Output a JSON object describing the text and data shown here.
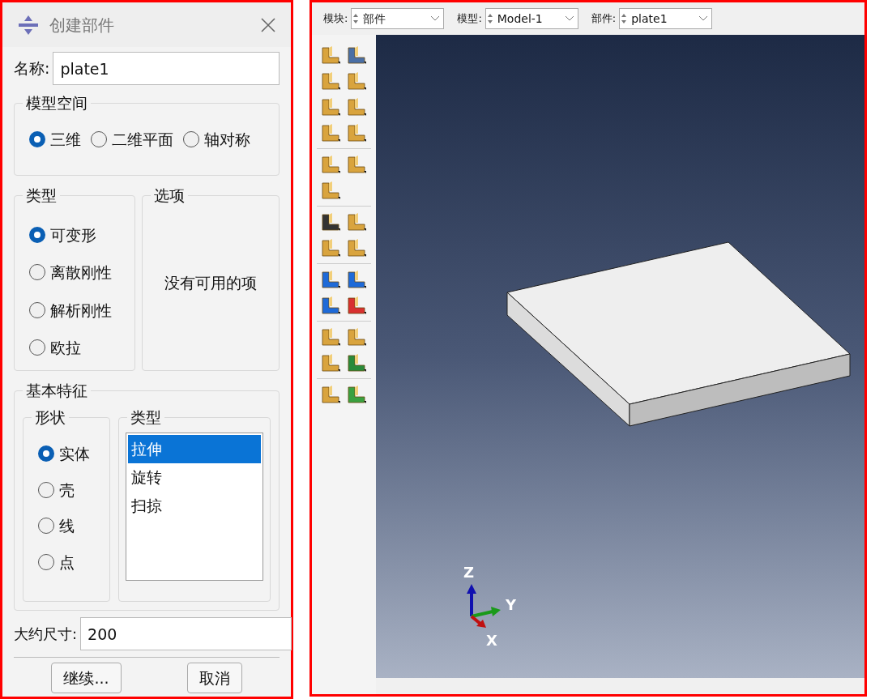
{
  "dialog": {
    "title": "创建部件",
    "name_label": "名称:",
    "name_value": "plate1",
    "model_space": {
      "title": "模型空间",
      "options": [
        {
          "label": "三维",
          "selected": true
        },
        {
          "label": "二维平面",
          "selected": false
        },
        {
          "label": "轴对称",
          "selected": false
        }
      ]
    },
    "type": {
      "title": "类型",
      "options": [
        {
          "label": "可变形",
          "selected": true
        },
        {
          "label": "离散刚性",
          "selected": false
        },
        {
          "label": "解析刚性",
          "selected": false
        },
        {
          "label": "欧拉",
          "selected": false
        }
      ]
    },
    "options_panel": {
      "title": "选项",
      "empty_text": "没有可用的项"
    },
    "base_feature": {
      "title": "基本特征",
      "shape": {
        "title": "形状",
        "options": [
          {
            "label": "实体",
            "selected": true
          },
          {
            "label": "壳",
            "selected": false
          },
          {
            "label": "线",
            "selected": false
          },
          {
            "label": "点",
            "selected": false
          }
        ]
      },
      "type": {
        "title": "类型",
        "items": [
          {
            "label": "拉伸",
            "selected": true
          },
          {
            "label": "旋转",
            "selected": false
          },
          {
            "label": "扫掠",
            "selected": false
          }
        ]
      }
    },
    "size_label": "大约尺寸:",
    "size_value": "200",
    "buttons": [
      "继续...",
      "取消"
    ]
  },
  "viewport": {
    "selectors": [
      {
        "label": "模块:",
        "value": "部件"
      },
      {
        "label": "模型:",
        "value": "Model-1"
      },
      {
        "label": "部件:",
        "value": "plate1"
      }
    ],
    "triad": {
      "z": "Z",
      "y": "Y",
      "x": "X"
    }
  }
}
